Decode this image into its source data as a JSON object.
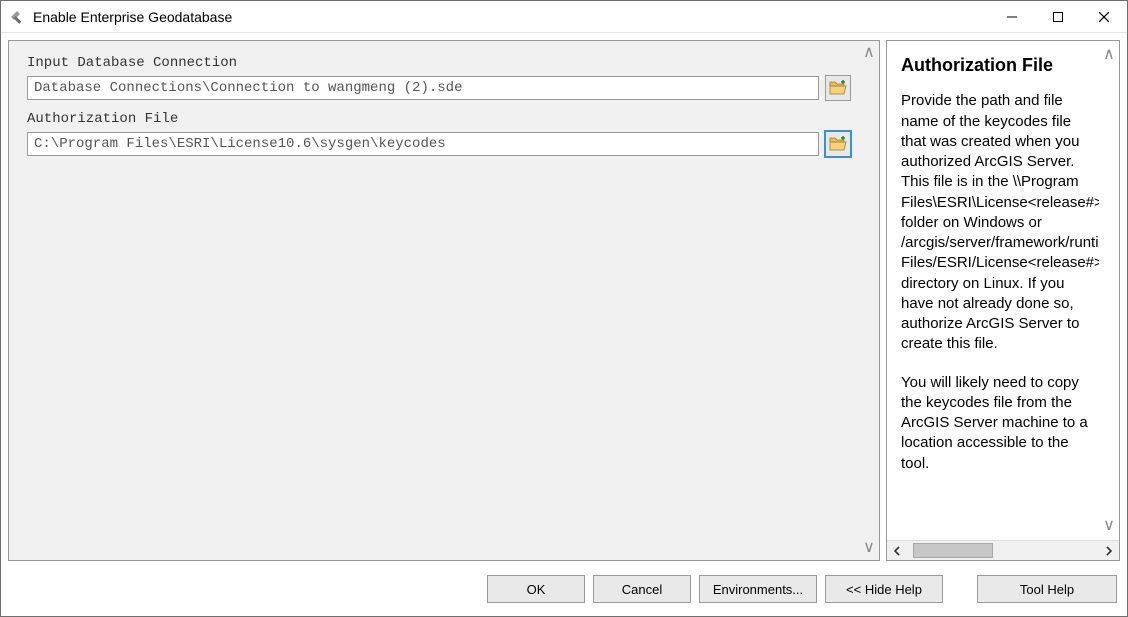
{
  "window": {
    "title": "Enable Enterprise Geodatabase"
  },
  "form": {
    "input_db": {
      "label": "Input Database Connection",
      "value": "Database Connections\\Connection to wangmeng (2).sde"
    },
    "auth_file": {
      "label": "Authorization File",
      "value": "C:\\Program Files\\ESRI\\License10.6\\sysgen\\keycodes"
    }
  },
  "help": {
    "heading": "Authorization File",
    "para1": "Provide the path and file name of the keycodes file that was created when you authorized ArcGIS Server. This file is in the \\\\Program Files\\ESRI\\License<release#> folder on Windows or /arcgis/server/framework/runtime/.wine/drive_c/Program Files/ESRI/License<release#> directory on Linux. If you have not already done so, authorize ArcGIS Server to create this file.",
    "para2": "You will likely need to copy the keycodes file from the ArcGIS Server machine to a location accessible to the tool."
  },
  "buttons": {
    "ok": "OK",
    "cancel": "Cancel",
    "environments": "Environments...",
    "hide_help": "<< Hide Help",
    "tool_help": "Tool Help"
  }
}
